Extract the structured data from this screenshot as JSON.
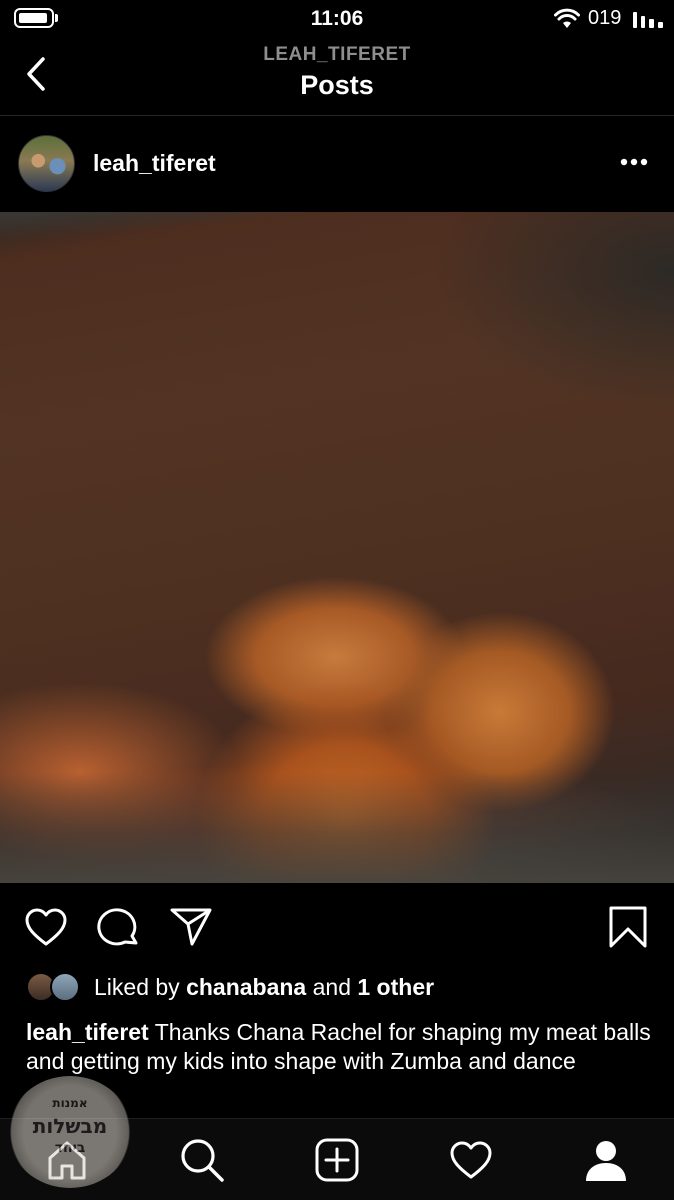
{
  "status_bar": {
    "time": "11:06",
    "carrier": "019",
    "icons": [
      "battery-icon",
      "wifi-icon",
      "signal-icon"
    ]
  },
  "header": {
    "username": "LEAH_TIFERET",
    "title": "Posts",
    "back_icon": "chevron-left-icon"
  },
  "post": {
    "author": "leah_tiferet",
    "more_icon": "more-horizontal-icon",
    "image_alt": "",
    "actions": [
      "heart-icon",
      "comment-icon",
      "share-icon",
      "bookmark-icon"
    ],
    "likes": {
      "prefix": "Liked by",
      "user": "chanabana",
      "joiner": "and",
      "others": "1 other"
    },
    "caption": {
      "author": "leah_tiferet",
      "text": "Thanks Chana Rachel for shaping my meat balls and getting my kids into shape with Zumba and dance"
    }
  },
  "tab_bar": {
    "tabs": [
      "home-icon",
      "search-icon",
      "add-post-icon",
      "activity-heart-icon",
      "profile-icon"
    ],
    "active": "home-icon"
  },
  "watermark": {
    "line1": "אמנות",
    "line2": "מבשלות",
    "line3": "ביחד"
  },
  "colors": {
    "background": "#000000",
    "text": "#ffffff",
    "secondary_text": "#8e8e8e"
  }
}
